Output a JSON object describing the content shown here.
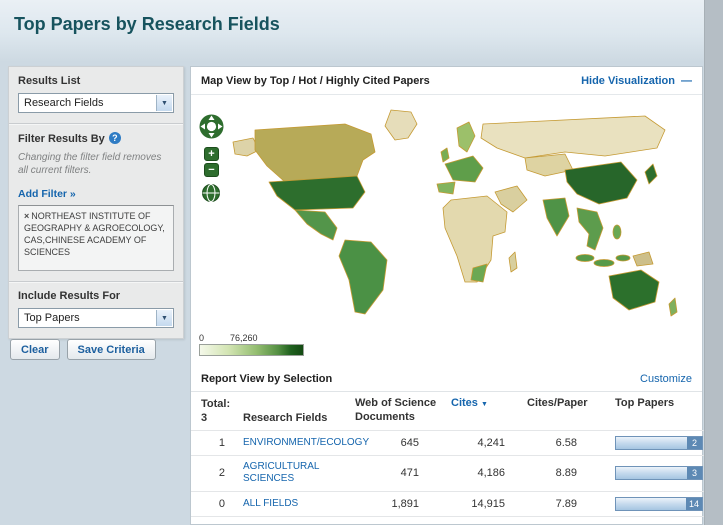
{
  "page": {
    "title": "Top Papers by Research Fields"
  },
  "icons": {
    "dropdown_arrow": "▼",
    "help": "?",
    "remove_filter": "×",
    "minimize": "—",
    "sort_desc": "▼",
    "zoom_in": "+",
    "zoom_out": "−"
  },
  "sidebar": {
    "results_list": {
      "label": "Results List",
      "value": "Research Fields"
    },
    "filter": {
      "label": "Filter Results By",
      "note": "Changing the filter field removes all current filters.",
      "add_filter_link": "Add Filter »",
      "chip_text": "NORTHEAST INSTITUTE OF GEOGRAPHY & AGROECOLOGY, CAS,CHINESE ACADEMY OF SCIENCES"
    },
    "include_results": {
      "label": "Include Results For",
      "value": "Top Papers"
    },
    "buttons": {
      "clear": "Clear",
      "save": "Save Criteria"
    }
  },
  "map_panel": {
    "title": "Map View by Top / Hot / Highly Cited Papers",
    "hide_link": "Hide Visualization",
    "legend": {
      "min": "0",
      "max": "76,260"
    },
    "colors": {
      "legend_low": "#f5f9ea",
      "legend_high": "#134a13",
      "accent_link": "#1565ad"
    }
  },
  "report": {
    "title": "Report View by Selection",
    "customize_link": "Customize",
    "total_label": "Total:",
    "total_value": "3",
    "columns": {
      "field": "Research Fields",
      "docs": "Web of Science Documents",
      "cites": "Cites",
      "cpp": "Cites/Paper",
      "top": "Top Papers"
    },
    "rows": [
      {
        "rank": "1",
        "field": "ENVIRONMENT/ECOLOGY",
        "docs": "645",
        "cites": "4,241",
        "cpp": "6.58",
        "top_papers": "2"
      },
      {
        "rank": "2",
        "field": "AGRICULTURAL SCIENCES",
        "docs": "471",
        "cites": "4,186",
        "cpp": "8.89",
        "top_papers": "3"
      },
      {
        "rank": "0",
        "field": "ALL FIELDS",
        "docs": "1,891",
        "cites": "14,915",
        "cpp": "7.89",
        "top_papers": "14"
      }
    ]
  },
  "chart_data": {
    "type": "table",
    "title": "Top Papers by Research Fields",
    "columns": [
      "Research Fields",
      "Web of Science Documents",
      "Cites",
      "Cites/Paper",
      "Top Papers"
    ],
    "rows": [
      [
        "ENVIRONMENT/ECOLOGY",
        645,
        4241,
        6.58,
        2
      ],
      [
        "AGRICULTURAL SCIENCES",
        471,
        4186,
        8.89,
        3
      ],
      [
        "ALL FIELDS",
        1891,
        14915,
        7.89,
        14
      ]
    ],
    "map_choropleth_legend_range": [
      0,
      76260
    ]
  }
}
